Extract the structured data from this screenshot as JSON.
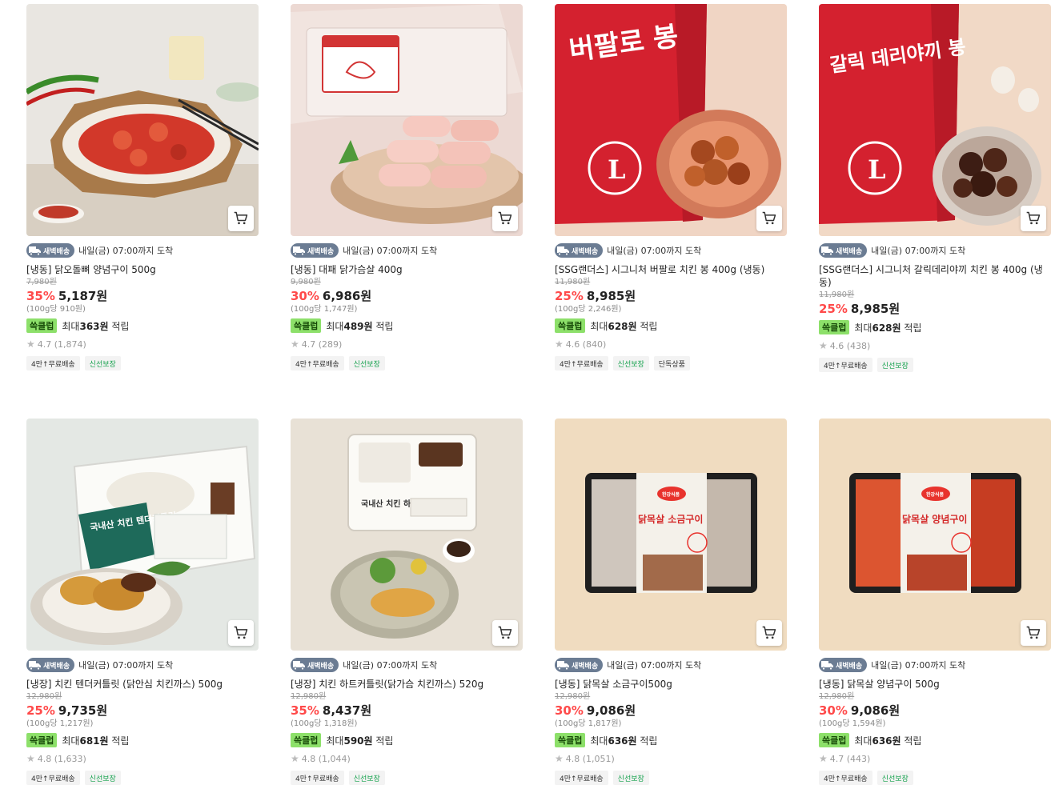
{
  "delivery_badge": "새벽배송",
  "points_badge": "쓱클럽",
  "points_prefix": "최대",
  "points_suffix": "적립",
  "products": [
    {
      "delivery_text": "내일(금) 07:00까지 도착",
      "name": "[냉동] 닭오돌뼈 양념구이 500g",
      "original_price": "7,980원",
      "discount": "35%",
      "price": "5,187원",
      "unit_price": "(100g당 910원)",
      "points": "363원",
      "rating": "4.7 (1,874)",
      "tags": [
        "4만↑무료배송",
        "신선보장"
      ]
    },
    {
      "delivery_text": "내일(금) 07:00까지 도착",
      "name": "[냉동] 대패 닭가슴살 400g",
      "original_price": "9,980원",
      "discount": "30%",
      "price": "6,986원",
      "unit_price": "(100g당 1,747원)",
      "points": "489원",
      "rating": "4.7 (289)",
      "tags": [
        "4만↑무료배송",
        "신선보장"
      ]
    },
    {
      "delivery_text": "내일(금) 07:00까지 도착",
      "name": "[SSG랜더스] 시그니처 버팔로 치킨 봉 400g (냉동)",
      "original_price": "11,980원",
      "discount": "25%",
      "price": "8,985원",
      "unit_price": "(100g당 2,246원)",
      "points": "628원",
      "rating": "4.6 (840)",
      "tags": [
        "4만↑무료배송",
        "신선보장",
        "단독상품"
      ]
    },
    {
      "delivery_text": "내일(금) 07:00까지 도착",
      "name": "[SSG랜더스] 시그니처 갈릭데리야끼 치킨 봉 400g (냉동)",
      "original_price": "11,980원",
      "discount": "25%",
      "price": "8,985원",
      "unit_price": "",
      "points": "628원",
      "rating": "4.6 (438)",
      "tags": [
        "4만↑무료배송",
        "신선보장"
      ]
    },
    {
      "delivery_text": "내일(금) 07:00까지 도착",
      "name": "[냉장] 치킨 텐더커틀릿 (닭안심 치킨까스) 500g",
      "original_price": "12,980원",
      "discount": "25%",
      "price": "9,735원",
      "unit_price": "(100g당 1,217원)",
      "points": "681원",
      "rating": "4.8 (1,633)",
      "tags": [
        "4만↑무료배송",
        "신선보장"
      ]
    },
    {
      "delivery_text": "내일(금) 07:00까지 도착",
      "name": "[냉장] 치킨 하트커틀릿(닭가슴 치킨까스) 520g",
      "original_price": "12,980원",
      "discount": "35%",
      "price": "8,437원",
      "unit_price": "(100g당 1,318원)",
      "points": "590원",
      "rating": "4.8 (1,044)",
      "tags": [
        "4만↑무료배송",
        "신선보장"
      ]
    },
    {
      "delivery_text": "내일(금) 07:00까지 도착",
      "name": "[냉동] 닭목살 소금구이500g",
      "original_price": "12,980원",
      "discount": "30%",
      "price": "9,086원",
      "unit_price": "(100g당 1,817원)",
      "points": "636원",
      "rating": "4.8 (1,051)",
      "tags": [
        "4만↑무료배송",
        "신선보장"
      ]
    },
    {
      "delivery_text": "내일(금) 07:00까지 도착",
      "name": "[냉동] 닭목살 양념구이 500g",
      "original_price": "12,980원",
      "discount": "30%",
      "price": "9,086원",
      "unit_price": "(100g당 1,594원)",
      "points": "636원",
      "rating": "4.7 (443)",
      "tags": [
        "4만↑무료배송",
        "신선보장"
      ]
    }
  ],
  "package_text": {
    "p3": "버팔로 봉",
    "p4": "갈릭 데리야끼 봉",
    "p5": "국내산 치킨 텐더커틀릿",
    "p6": "국내산 치킨 하트커틀릿",
    "p7_brand": "한강식품",
    "p7_title": "닭목살 소금구이",
    "p8_brand": "한강식품",
    "p8_title": "닭목살 양념구이"
  },
  "icons": {
    "cart": "cart-icon",
    "truck": "truck-icon",
    "star": "star-icon"
  },
  "colors": {
    "discount": "#ff4a4a",
    "club": "#8de06a",
    "badge": "#6b7c93",
    "fresh": "#14a14c"
  }
}
